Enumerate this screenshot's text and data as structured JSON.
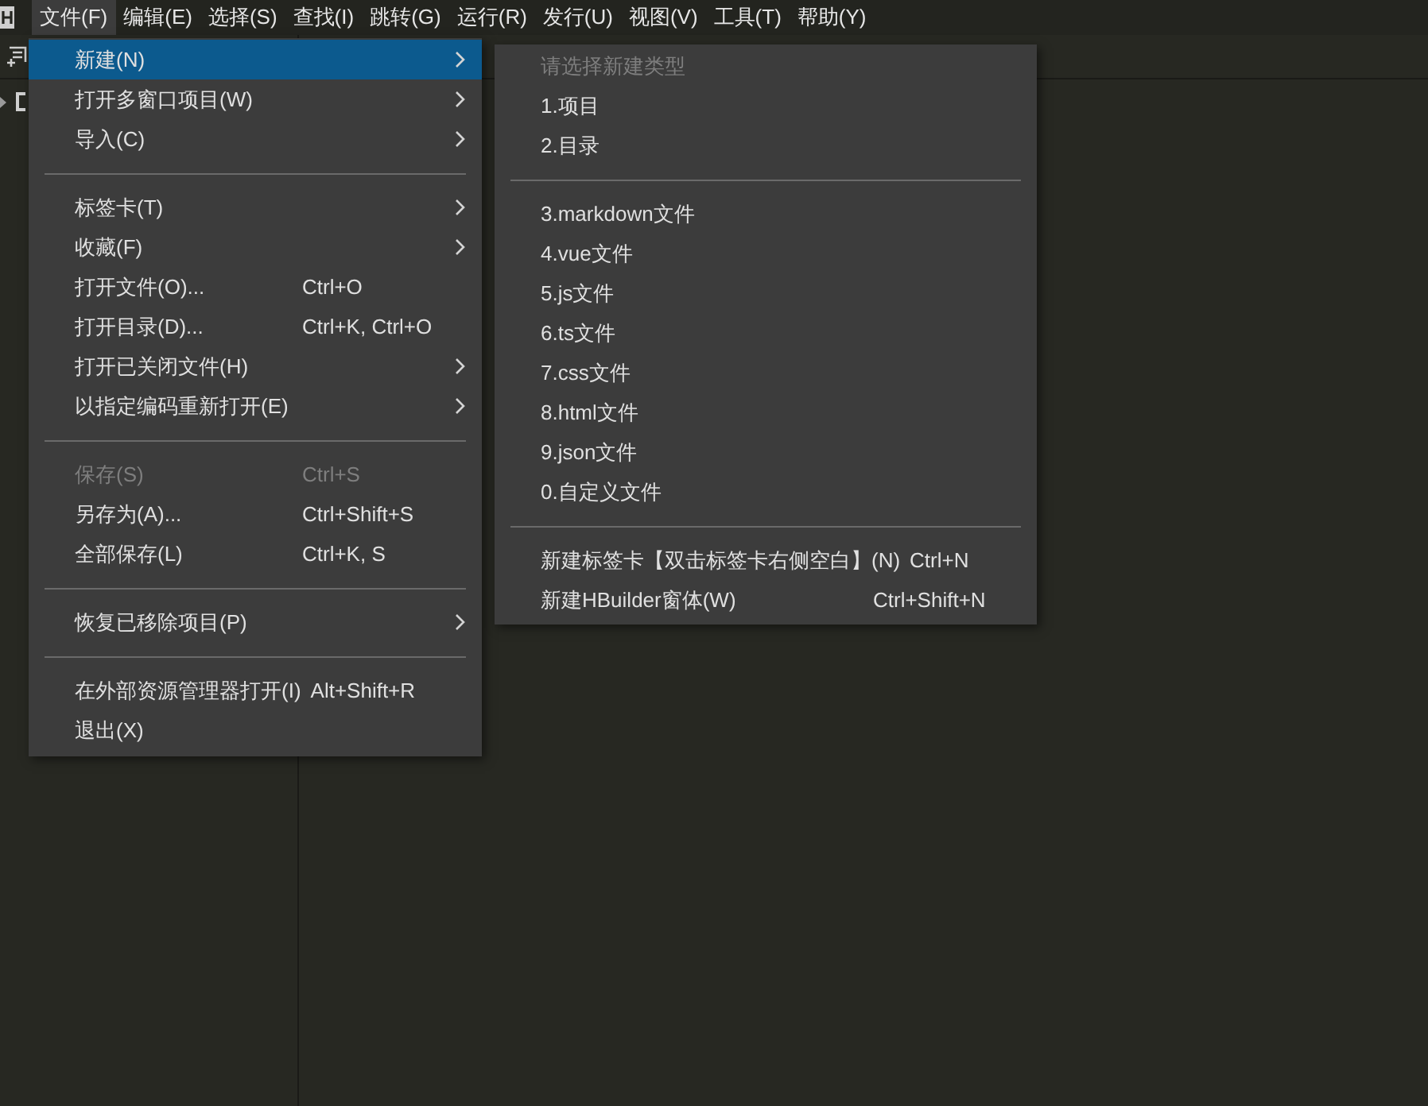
{
  "menu_bar": [
    {
      "label": "文件(F)",
      "selected": true
    },
    {
      "label": "编辑(E)",
      "selected": false
    },
    {
      "label": "选择(S)",
      "selected": false
    },
    {
      "label": "查找(I)",
      "selected": false
    },
    {
      "label": "跳转(G)",
      "selected": false
    },
    {
      "label": "运行(R)",
      "selected": false
    },
    {
      "label": "发行(U)",
      "selected": false
    },
    {
      "label": "视图(V)",
      "selected": false
    },
    {
      "label": "工具(T)",
      "selected": false
    },
    {
      "label": "帮助(Y)",
      "selected": false
    }
  ],
  "file_menu": [
    {
      "kind": "item",
      "label": "新建(N)",
      "submenu": true,
      "selected": true,
      "disabled": false
    },
    {
      "kind": "item",
      "label": "打开多窗口项目(W)",
      "submenu": true,
      "selected": false,
      "disabled": false
    },
    {
      "kind": "item",
      "label": "导入(C)",
      "submenu": true,
      "selected": false,
      "disabled": false
    },
    {
      "kind": "separator"
    },
    {
      "kind": "item",
      "label": "标签卡(T)",
      "submenu": true,
      "selected": false,
      "disabled": false
    },
    {
      "kind": "item",
      "label": "收藏(F)",
      "submenu": true,
      "selected": false,
      "disabled": false
    },
    {
      "kind": "item",
      "label": "打开文件(O)...",
      "shortcut": "Ctrl+O",
      "submenu": false,
      "selected": false,
      "disabled": false
    },
    {
      "kind": "item",
      "label": "打开目录(D)...",
      "shortcut": "Ctrl+K, Ctrl+O",
      "submenu": false,
      "selected": false,
      "disabled": false
    },
    {
      "kind": "item",
      "label": "打开已关闭文件(H)",
      "submenu": true,
      "selected": false,
      "disabled": false
    },
    {
      "kind": "item",
      "label": "以指定编码重新打开(E)",
      "submenu": true,
      "selected": false,
      "disabled": false
    },
    {
      "kind": "separator"
    },
    {
      "kind": "item",
      "label": "保存(S)",
      "shortcut": "Ctrl+S",
      "submenu": false,
      "selected": false,
      "disabled": true
    },
    {
      "kind": "item",
      "label": "另存为(A)...",
      "shortcut": "Ctrl+Shift+S",
      "submenu": false,
      "selected": false,
      "disabled": false
    },
    {
      "kind": "item",
      "label": "全部保存(L)",
      "shortcut": "Ctrl+K, S",
      "submenu": false,
      "selected": false,
      "disabled": false
    },
    {
      "kind": "separator"
    },
    {
      "kind": "item",
      "label": "恢复已移除项目(P)",
      "submenu": true,
      "selected": false,
      "disabled": false
    },
    {
      "kind": "separator"
    },
    {
      "kind": "item",
      "label": "在外部资源管理器打开(I)",
      "shortcut": "Alt+Shift+R",
      "submenu": false,
      "selected": false,
      "disabled": false
    },
    {
      "kind": "item",
      "label": "退出(X)",
      "submenu": false,
      "selected": false,
      "disabled": false
    }
  ],
  "new_submenu": [
    {
      "kind": "item",
      "label": "请选择新建类型",
      "disabled": true
    },
    {
      "kind": "item",
      "label": "1.项目",
      "disabled": false
    },
    {
      "kind": "item",
      "label": "2.目录",
      "disabled": false
    },
    {
      "kind": "separator"
    },
    {
      "kind": "item",
      "label": "3.markdown文件",
      "disabled": false
    },
    {
      "kind": "item",
      "label": "4.vue文件",
      "disabled": false
    },
    {
      "kind": "item",
      "label": "5.js文件",
      "disabled": false
    },
    {
      "kind": "item",
      "label": "6.ts文件",
      "disabled": false
    },
    {
      "kind": "item",
      "label": "7.css文件",
      "disabled": false
    },
    {
      "kind": "item",
      "label": "8.html文件",
      "disabled": false
    },
    {
      "kind": "item",
      "label": "9.json文件",
      "disabled": false
    },
    {
      "kind": "item",
      "label": "0.自定义文件",
      "disabled": false
    },
    {
      "kind": "separator"
    },
    {
      "kind": "item",
      "label": "新建标签卡【双击标签卡右侧空白】(N)",
      "shortcut": "Ctrl+N",
      "disabled": false
    },
    {
      "kind": "item",
      "label": "新建HBuilder窗体(W)",
      "shortcut": "Ctrl+Shift+N",
      "disabled": false
    }
  ]
}
